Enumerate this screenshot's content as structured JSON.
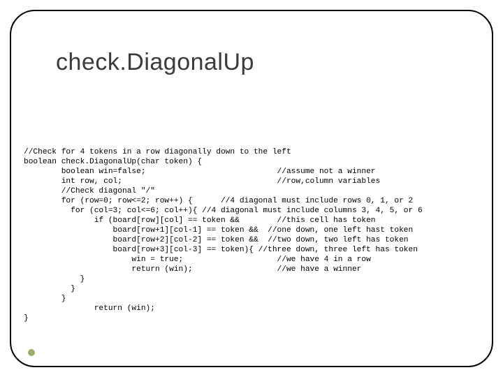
{
  "title": "check.DiagonalUp",
  "code_lines": [
    "//Check for 4 tokens in a row diagonally down to the left",
    "boolean check.DiagonalUp(char token) {",
    "        boolean win=false;                            //assume not a winner",
    "        int row, col;                                 //row,column variables",
    "        //Check diagonal \"/\"",
    "        for (row=0; row<=2; row++) {      //4 diagonal must include rows 0, 1, or 2",
    "          for (col=3; col<=6; col++){ //4 diagonal must include columns 3, 4, 5, or 6",
    "               if (board[row][col] == token &&        //this cell has token",
    "                   board[row+1][col-1] == token &&  //one down, one left hast token",
    "                   board[row+2][col-2] == token &&  //two down, two left has token",
    "                   board[row+3][col-3] == token){ //three down, three left has token",
    "                       win = true;                    //we have 4 in a row",
    "                       return (win);                  //we have a winner",
    "            }",
    "          }",
    "        }",
    "               return (win);",
    "}"
  ]
}
